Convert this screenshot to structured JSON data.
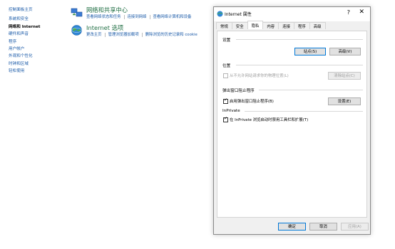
{
  "left_nav": {
    "home": "控制面板主页",
    "items": [
      "系统和安全",
      "网络和 Internet",
      "硬件和声音",
      "程序",
      "用户帐户",
      "外观和个性化",
      "时钟和区域",
      "轻松使用"
    ],
    "active_index": 1
  },
  "categories": [
    {
      "title": "网络和共享中心",
      "links": [
        "查看网络状态和任务",
        "连接到网络",
        "查看网络计算机和设备"
      ]
    },
    {
      "title": "Internet 选项",
      "links": [
        "更改主页",
        "管理浏览器加载项",
        "删除浏览的历史记录和 cookie"
      ]
    }
  ],
  "dialog": {
    "title": "Internet 属性",
    "help": "?",
    "close": "✕",
    "tabs": [
      "常规",
      "安全",
      "隐私",
      "内容",
      "连接",
      "程序",
      "高级"
    ],
    "active_tab": 2,
    "settings": {
      "header": "设置",
      "sites_button": "站点(S)",
      "advanced_button": "高级(V)"
    },
    "location": {
      "header": "位置",
      "checkbox": "从不允许网站请求你的物理位置(L)",
      "clear_button": "清除站点(C)"
    },
    "popup": {
      "header": "弹出窗口阻止程序",
      "checkbox": "启用弹出窗口阻止程序(B)",
      "settings_button": "设置(E)"
    },
    "inprivate": {
      "header": "InPrivate",
      "checkbox": "在 InPrivate 浏览启动时禁用工具栏和扩展(T)"
    },
    "ok": "确定",
    "cancel": "取消",
    "apply": "应用(A)"
  },
  "colors": {
    "accent": "#0078d7",
    "link": "#1a5aa8",
    "category_title": "#1f6e43"
  }
}
